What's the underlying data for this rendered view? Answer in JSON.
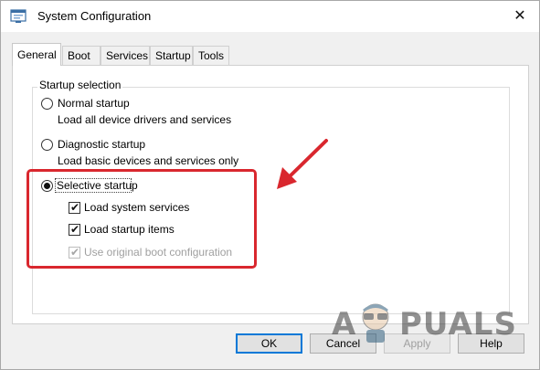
{
  "window": {
    "title": "System Configuration",
    "close_glyph": "✕",
    "app_icon": "msconfig-icon"
  },
  "tabs": [
    {
      "label": "General",
      "active": true
    },
    {
      "label": "Boot",
      "active": false
    },
    {
      "label": "Services",
      "active": false
    },
    {
      "label": "Startup",
      "active": false
    },
    {
      "label": "Tools",
      "active": false
    }
  ],
  "startup_selection": {
    "group_label": "Startup selection",
    "normal": {
      "label": "Normal startup",
      "description": "Load all device drivers and services",
      "selected": false
    },
    "diagnostic": {
      "label": "Diagnostic startup",
      "description": "Load basic devices and services only",
      "selected": false
    },
    "selective": {
      "label": "Selective startup",
      "selected": true,
      "load_system_services": {
        "label": "Load system services",
        "checked": true
      },
      "load_startup_items": {
        "label": "Load startup items",
        "checked": true
      },
      "use_original_boot_config": {
        "label": "Use original boot configuration",
        "checked": true,
        "disabled": true
      }
    }
  },
  "buttons": {
    "ok": "OK",
    "cancel": "Cancel",
    "apply": "Apply",
    "help": "Help"
  },
  "watermark": {
    "text_left": "A",
    "text_right": "PUALS"
  },
  "colors": {
    "highlight": "#d9272e",
    "focus_blue": "#0078d7"
  }
}
